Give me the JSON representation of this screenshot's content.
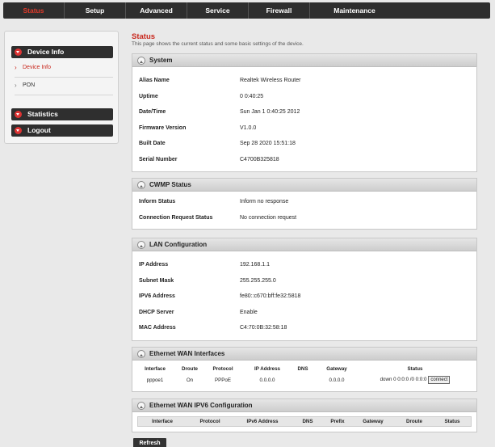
{
  "nav": {
    "items": [
      {
        "label": "Status"
      },
      {
        "label": "Setup"
      },
      {
        "label": "Advanced"
      },
      {
        "label": "Service"
      },
      {
        "label": "Firewall"
      },
      {
        "label": "Maintenance"
      }
    ],
    "active_color": "#e03a2a"
  },
  "sidebar": {
    "device_info": "Device Info",
    "device_info_link": "Device Info",
    "pon_link": "PON",
    "statistics": "Statistics",
    "logout": "Logout"
  },
  "page": {
    "title": "Status",
    "description": "This page shows the current status and some basic settings of the device."
  },
  "system": {
    "title": "System",
    "rows": [
      {
        "key": "Alias Name",
        "value": "Realtek Wireless Router"
      },
      {
        "key": "Uptime",
        "value": "0 0:40:25"
      },
      {
        "key": "Date/Time",
        "value": "Sun Jan 1 0:40:25 2012"
      },
      {
        "key": "Firmware Version",
        "value": "V1.0.0"
      },
      {
        "key": "Built Date",
        "value": "Sep 28 2020 15:51:18"
      },
      {
        "key": "Serial Number",
        "value": "C4700B325818"
      }
    ]
  },
  "cwmp": {
    "title": "CWMP Status",
    "rows": [
      {
        "key": "Inform Status",
        "value": "Inform no response"
      },
      {
        "key": "Connection Request Status",
        "value": "No connection request"
      }
    ]
  },
  "lan": {
    "title": "LAN Configuration",
    "rows": [
      {
        "key": "IP Address",
        "value": "192.168.1.1"
      },
      {
        "key": "Subnet Mask",
        "value": "255.255.255.0"
      },
      {
        "key": "IPV6 Address",
        "value": "fe80::c670:bff:fe32:5818"
      },
      {
        "key": "DHCP Server",
        "value": "Enable"
      },
      {
        "key": "MAC Address",
        "value": "C4:70:0B:32:58:18"
      }
    ]
  },
  "wan": {
    "title": "Ethernet WAN Interfaces",
    "headers": [
      "Interface",
      "Droute",
      "Protocol",
      "IP Address",
      "DNS",
      "Gateway",
      "Status"
    ],
    "row": {
      "interface": "pppoe1",
      "droute": "On",
      "protocol": "PPPoE",
      "ip": "0.0.0.0",
      "dns": "",
      "gateway": "0.0.0.0",
      "status": "down 0 0:0:0 /0 0:0:0",
      "connect_label": "connect"
    }
  },
  "wan6": {
    "title": "Ethernet WAN IPV6 Configuration",
    "headers": [
      "Interface",
      "Protocol",
      "IPv6 Address",
      "DNS",
      "Prefix",
      "Gateway",
      "Droute",
      "Status"
    ]
  },
  "refresh_label": "Refresh"
}
